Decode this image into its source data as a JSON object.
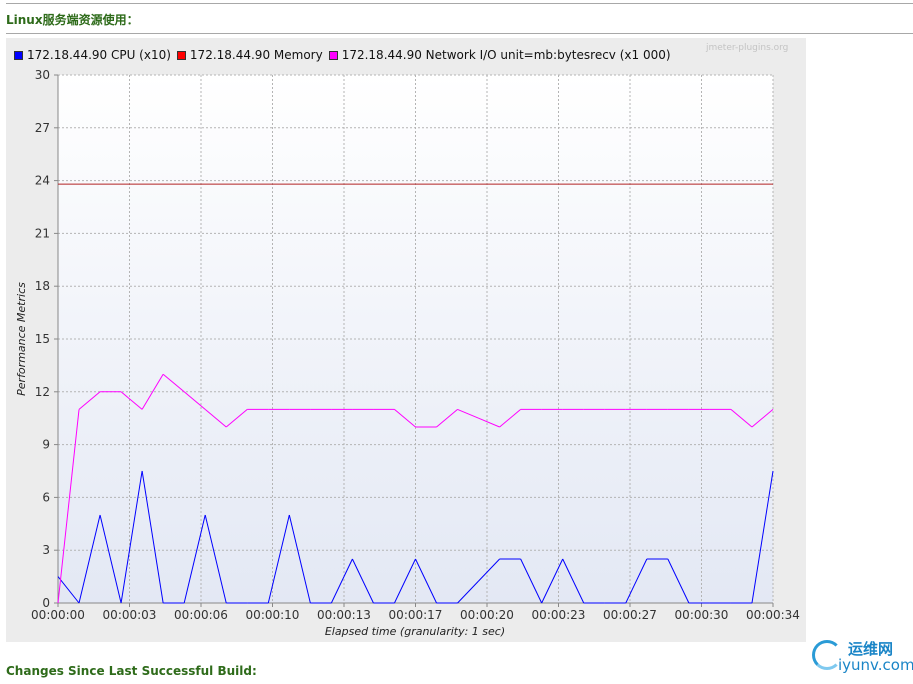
{
  "page": {
    "section_title": "Linux服务端资源使用：",
    "footer_title": "Changes Since Last Successful Build:"
  },
  "watermark": "jmeter-plugins.org",
  "logo": {
    "text_cn": "运维网",
    "text_en": "iyunv.com"
  },
  "chart_data": {
    "type": "line",
    "title": "",
    "xlabel": "Elapsed time (granularity: 1 sec)",
    "ylabel": "Performance Metrics",
    "xlim": [
      0,
      34
    ],
    "ylim": [
      0,
      30
    ],
    "y_ticks": [
      0,
      3,
      6,
      9,
      12,
      15,
      18,
      21,
      24,
      27,
      30
    ],
    "x_ticks": [
      "00:00:00",
      "00:00:03",
      "00:00:06",
      "00:00:10",
      "00:00:13",
      "00:00:17",
      "00:00:20",
      "00:00:23",
      "00:00:27",
      "00:00:30",
      "00:00:34"
    ],
    "x_tick_seconds": [
      0,
      3.4,
      6.8,
      10.2,
      13.6,
      17,
      20.4,
      23.8,
      27.2,
      30.6,
      34
    ],
    "grid": true,
    "legend_position": "top-left",
    "series": [
      {
        "name": "172.18.44.90 CPU (x10)",
        "color": "#0000ff",
        "x": [
          0,
          1,
          2,
          3,
          4,
          5,
          6,
          7,
          8,
          9,
          10,
          11,
          12,
          13,
          14,
          15,
          16,
          17,
          18,
          19,
          20,
          21,
          22,
          23,
          24,
          25,
          26,
          27,
          28,
          29,
          30,
          31,
          32,
          33,
          34
        ],
        "y": [
          1.5,
          0,
          5,
          0,
          7.5,
          0,
          0,
          5,
          0,
          0,
          0,
          5,
          0,
          0,
          2.5,
          0,
          0,
          2.5,
          0,
          0,
          1.25,
          2.5,
          2.5,
          0,
          2.5,
          0,
          0,
          0,
          2.5,
          2.5,
          0,
          0,
          0,
          0,
          7.5
        ]
      },
      {
        "name": "172.18.44.90 Memory",
        "color": "#b22222",
        "legend_color": "#ff0000",
        "x": [
          0,
          34
        ],
        "y": [
          23.8,
          23.8
        ]
      },
      {
        "name": "172.18.44.90 Network I/O unit=mb:bytesrecv (x1 000)",
        "color": "#ff00ff",
        "x": [
          0,
          1,
          2,
          3,
          4,
          5,
          6,
          7,
          8,
          9,
          10,
          11,
          12,
          13,
          14,
          15,
          16,
          17,
          18,
          19,
          20,
          21,
          22,
          23,
          24,
          25,
          26,
          27,
          28,
          29,
          30,
          31,
          32,
          33,
          34
        ],
        "y": [
          0,
          11,
          12,
          12,
          11,
          13,
          12,
          11,
          10,
          11,
          11,
          11,
          11,
          11,
          11,
          11,
          11,
          10,
          10,
          11,
          10.5,
          10,
          11,
          11,
          11,
          11,
          11,
          11,
          11,
          11,
          11,
          11,
          11,
          10,
          11
        ]
      }
    ]
  }
}
